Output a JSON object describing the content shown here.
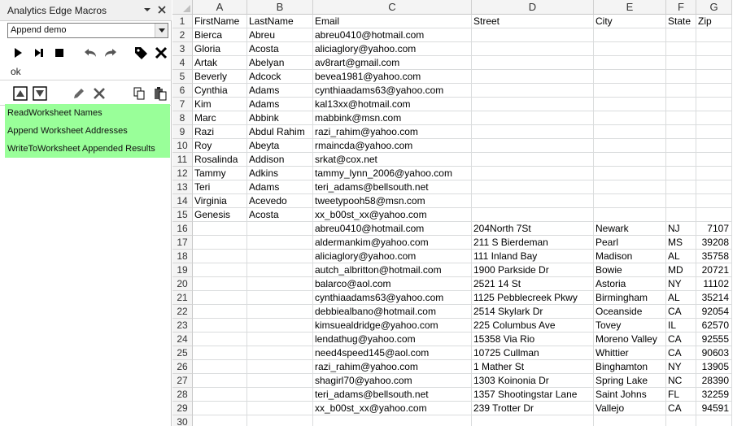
{
  "pane": {
    "title": "Analytics Edge Macros",
    "macro_select": "Append demo",
    "status": "ok",
    "macros": [
      "ReadWorksheet Names",
      "Append Worksheet Addresses",
      "WriteToWorksheet Appended Results"
    ],
    "icons": {
      "toolbar1": [
        "play-icon",
        "step-icon",
        "stop-icon",
        "undo-icon",
        "redo-icon",
        "tag-icon",
        "delete-icon"
      ],
      "toolbar2": [
        "move-up-icon",
        "move-down-icon",
        "edit-icon",
        "remove-icon",
        "copy-icon",
        "paste-icon"
      ]
    },
    "colors": {
      "macro_highlight": "#99ff99"
    }
  },
  "sheet": {
    "columns": [
      "A",
      "B",
      "C",
      "D",
      "E",
      "F",
      "G"
    ],
    "rows": [
      {
        "n": "1",
        "cells": [
          "FirstName",
          "LastName",
          "Email",
          "Street",
          "City",
          "State",
          "Zip"
        ]
      },
      {
        "n": "2",
        "cells": [
          "Bierca",
          "Abreu",
          "abreu0410@hotmail.com",
          "",
          "",
          "",
          ""
        ]
      },
      {
        "n": "3",
        "cells": [
          "Gloria",
          "Acosta",
          "aliciaglory@yahoo.com",
          "",
          "",
          "",
          ""
        ]
      },
      {
        "n": "4",
        "cells": [
          "Artak",
          "Abelyan",
          "av8rart@gmail.com",
          "",
          "",
          "",
          ""
        ]
      },
      {
        "n": "5",
        "cells": [
          "Beverly",
          "Adcock",
          "bevea1981@yahoo.com",
          "",
          "",
          "",
          ""
        ]
      },
      {
        "n": "6",
        "cells": [
          "Cynthia",
          "Adams",
          "cynthiaadams63@yahoo.com",
          "",
          "",
          "",
          ""
        ]
      },
      {
        "n": "7",
        "cells": [
          "Kim",
          "Adams",
          "kal13xx@hotmail.com",
          "",
          "",
          "",
          ""
        ]
      },
      {
        "n": "8",
        "cells": [
          "Marc",
          "Abbink",
          "mabbink@msn.com",
          "",
          "",
          "",
          ""
        ]
      },
      {
        "n": "9",
        "cells": [
          "Razi",
          "Abdul Rahim",
          "razi_rahim@yahoo.com",
          "",
          "",
          "",
          ""
        ]
      },
      {
        "n": "10",
        "cells": [
          "Roy",
          "Abeyta",
          "rmaincda@yahoo.com",
          "",
          "",
          "",
          ""
        ]
      },
      {
        "n": "11",
        "cells": [
          "Rosalinda",
          "Addison",
          "srkat@cox.net",
          "",
          "",
          "",
          ""
        ]
      },
      {
        "n": "12",
        "cells": [
          "Tammy",
          "Adkins",
          "tammy_lynn_2006@yahoo.com",
          "",
          "",
          "",
          ""
        ]
      },
      {
        "n": "13",
        "cells": [
          "Teri",
          "Adams",
          "teri_adams@bellsouth.net",
          "",
          "",
          "",
          ""
        ]
      },
      {
        "n": "14",
        "cells": [
          "Virginia",
          "Acevedo",
          "tweetypooh58@msn.com",
          "",
          "",
          "",
          ""
        ]
      },
      {
        "n": "15",
        "cells": [
          "Genesis",
          "Acosta",
          "xx_b00st_xx@yahoo.com",
          "",
          "",
          "",
          ""
        ]
      },
      {
        "n": "16",
        "cells": [
          "",
          "",
          "abreu0410@hotmail.com",
          "204North 7St",
          "Newark",
          "NJ",
          "7107"
        ]
      },
      {
        "n": "17",
        "cells": [
          "",
          "",
          "aldermankim@yahoo.com",
          "211 S Bierdeman",
          "Pearl",
          "MS",
          "39208"
        ]
      },
      {
        "n": "18",
        "cells": [
          "",
          "",
          "aliciaglory@yahoo.com",
          "111 Inland Bay",
          "Madison",
          "AL",
          "35758"
        ]
      },
      {
        "n": "19",
        "cells": [
          "",
          "",
          "autch_albritton@hotmail.com",
          "1900 Parkside Dr",
          "Bowie",
          "MD",
          "20721"
        ]
      },
      {
        "n": "20",
        "cells": [
          "",
          "",
          "balarco@aol.com",
          "2521 14 St",
          "Astoria",
          "NY",
          "11102"
        ]
      },
      {
        "n": "21",
        "cells": [
          "",
          "",
          "cynthiaadams63@yahoo.com",
          "1125 Pebblecreek Pkwy",
          "Birmingham",
          "AL",
          "35214"
        ]
      },
      {
        "n": "22",
        "cells": [
          "",
          "",
          "debbiealbano@hotmail.com",
          "2514 Skylark Dr",
          "Oceanside",
          "CA",
          "92054"
        ]
      },
      {
        "n": "23",
        "cells": [
          "",
          "",
          "kimsuealdridge@yahoo.com",
          "225 Columbus Ave",
          "Tovey",
          "IL",
          "62570"
        ]
      },
      {
        "n": "24",
        "cells": [
          "",
          "",
          "lendathug@yahoo.com",
          "15358 Via Rio",
          "Moreno Valley",
          "CA",
          "92555"
        ]
      },
      {
        "n": "25",
        "cells": [
          "",
          "",
          "need4speed145@aol.com",
          "10725 Cullman",
          "Whittier",
          "CA",
          "90603"
        ]
      },
      {
        "n": "26",
        "cells": [
          "",
          "",
          "razi_rahim@yahoo.com",
          "1 Mather St",
          "Binghamton",
          "NY",
          "13905"
        ]
      },
      {
        "n": "27",
        "cells": [
          "",
          "",
          "shagirl70@yahoo.com",
          "1303 Koinonia Dr",
          "Spring Lake",
          "NC",
          "28390"
        ]
      },
      {
        "n": "28",
        "cells": [
          "",
          "",
          "teri_adams@bellsouth.net",
          "1357 Shootingstar Lane",
          "Saint Johns",
          "FL",
          "32259"
        ]
      },
      {
        "n": "29",
        "cells": [
          "",
          "",
          "xx_b00st_xx@yahoo.com",
          "239 Trotter Dr",
          "Vallejo",
          "CA",
          "94591"
        ]
      },
      {
        "n": "30",
        "cells": [
          "",
          "",
          "",
          "",
          "",
          "",
          ""
        ]
      }
    ]
  }
}
